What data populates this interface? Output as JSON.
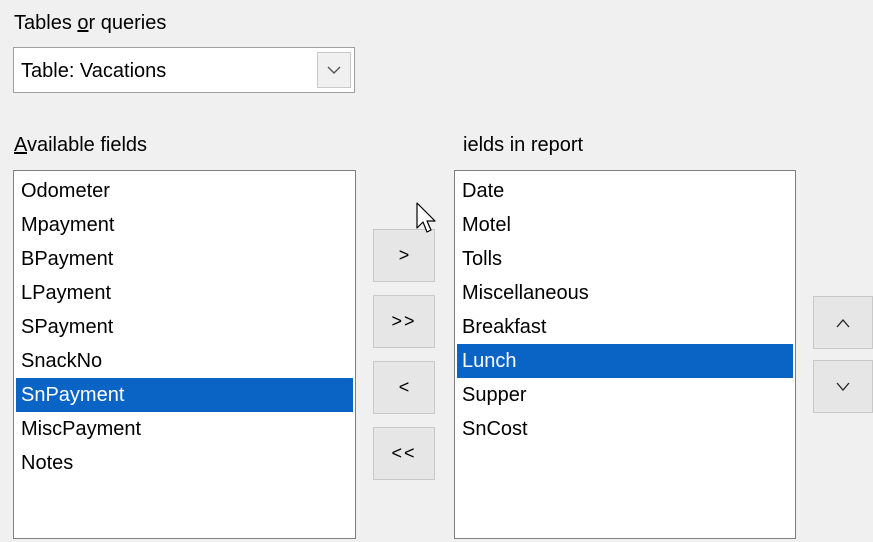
{
  "tables_label": {
    "before": "Tables ",
    "accel": "o",
    "after": "r queries"
  },
  "table_combo": {
    "value": "Table: Vacations",
    "icon": "chevron-down-icon"
  },
  "available_label": {
    "accel": "A",
    "after": "vailable fields"
  },
  "available_fields": [
    "Odometer",
    "Mpayment",
    "BPayment",
    "LPayment",
    "SPayment",
    "SnackNo",
    "SnPayment",
    "MiscPayment",
    "Notes"
  ],
  "available_selected_index": 6,
  "report_label": "ields in report",
  "report_fields": [
    "Date",
    "Motel",
    "Tolls",
    "Miscellaneous",
    "Breakfast",
    "Lunch",
    "Supper",
    "SnCost"
  ],
  "report_selected_index": 5,
  "buttons": {
    "add": ">",
    "add_all": ">>",
    "remove": "<",
    "remove_all": "<<",
    "move_up": "^",
    "move_down": "v"
  },
  "colors": {
    "selection": "#0a64c6",
    "dialog_bg": "#f0f0f0",
    "button_bg": "#e6e6e6"
  }
}
